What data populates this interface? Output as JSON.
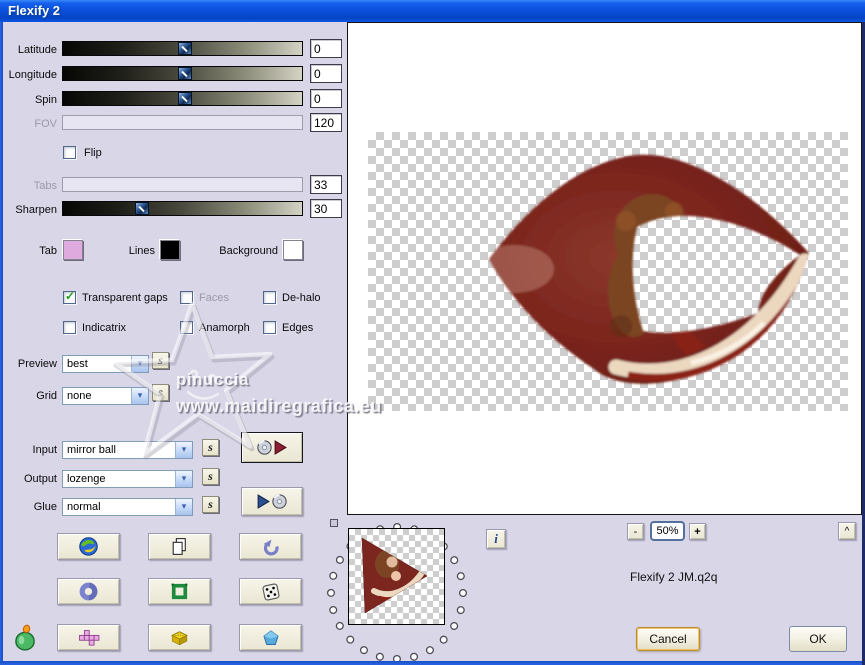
{
  "window": {
    "title": "Flexify 2"
  },
  "panel": {
    "sliders": {
      "latitude": {
        "label": "Latitude",
        "value": "0",
        "position_pct": 48,
        "disabled": false
      },
      "longitude": {
        "label": "Longitude",
        "value": "0",
        "position_pct": 48,
        "disabled": false
      },
      "spin": {
        "label": "Spin",
        "value": "0",
        "position_pct": 48,
        "disabled": false
      },
      "fov": {
        "label": "FOV",
        "value": "120",
        "disabled": true
      },
      "tabs": {
        "label": "Tabs",
        "value": "33",
        "disabled": true
      },
      "sharpen": {
        "label": "Sharpen",
        "value": "30",
        "position_pct": 30,
        "disabled": false
      }
    },
    "flip": {
      "label": "Flip",
      "checked": false
    },
    "swatches": {
      "tab": {
        "label": "Tab",
        "color": "#dfaade"
      },
      "lines": {
        "label": "Lines",
        "color": "#000000"
      },
      "background": {
        "label": "Background",
        "color": "#ffffff"
      }
    },
    "checks": {
      "transparent_gaps": {
        "label": "Transparent gaps",
        "checked": true,
        "disabled": false
      },
      "faces": {
        "label": "Faces",
        "checked": false,
        "disabled": true
      },
      "dehalo": {
        "label": "De-halo",
        "checked": false,
        "disabled": false
      },
      "indicatrix": {
        "label": "Indicatrix",
        "checked": false,
        "disabled": false
      },
      "anamorph": {
        "label": "Anamorph",
        "checked": false,
        "disabled": false
      },
      "edges": {
        "label": "Edges",
        "checked": false,
        "disabled": false
      }
    },
    "combos": {
      "preview": {
        "label": "Preview",
        "value": "best"
      },
      "grid": {
        "label": "Grid",
        "value": "none"
      },
      "input": {
        "label": "Input",
        "value": "mirror ball"
      },
      "output": {
        "label": "Output",
        "value": "lozenge"
      },
      "glue": {
        "label": "Glue",
        "value": "normal"
      }
    },
    "s_glyph": "s"
  },
  "watermark": {
    "name": "pinuccia",
    "site": "www.maidiregrafica.eu"
  },
  "footer": {
    "info": "i",
    "zoom_out": "-",
    "zoom_level": "50%",
    "zoom_in": "+",
    "collapse": "^",
    "preset": "Flexify 2 JM.q2q",
    "cancel": "Cancel",
    "ok": "OK"
  },
  "icons": {
    "check": "✓",
    "chevron": "▾"
  },
  "colors": {
    "titlebar_blue": "#0a50dc",
    "dialog_bg": "#d9d6e8",
    "focus_ring_gold": "#c08a28",
    "tab_swatch_pink": "#dfaade",
    "image_red": "#7a241c"
  }
}
